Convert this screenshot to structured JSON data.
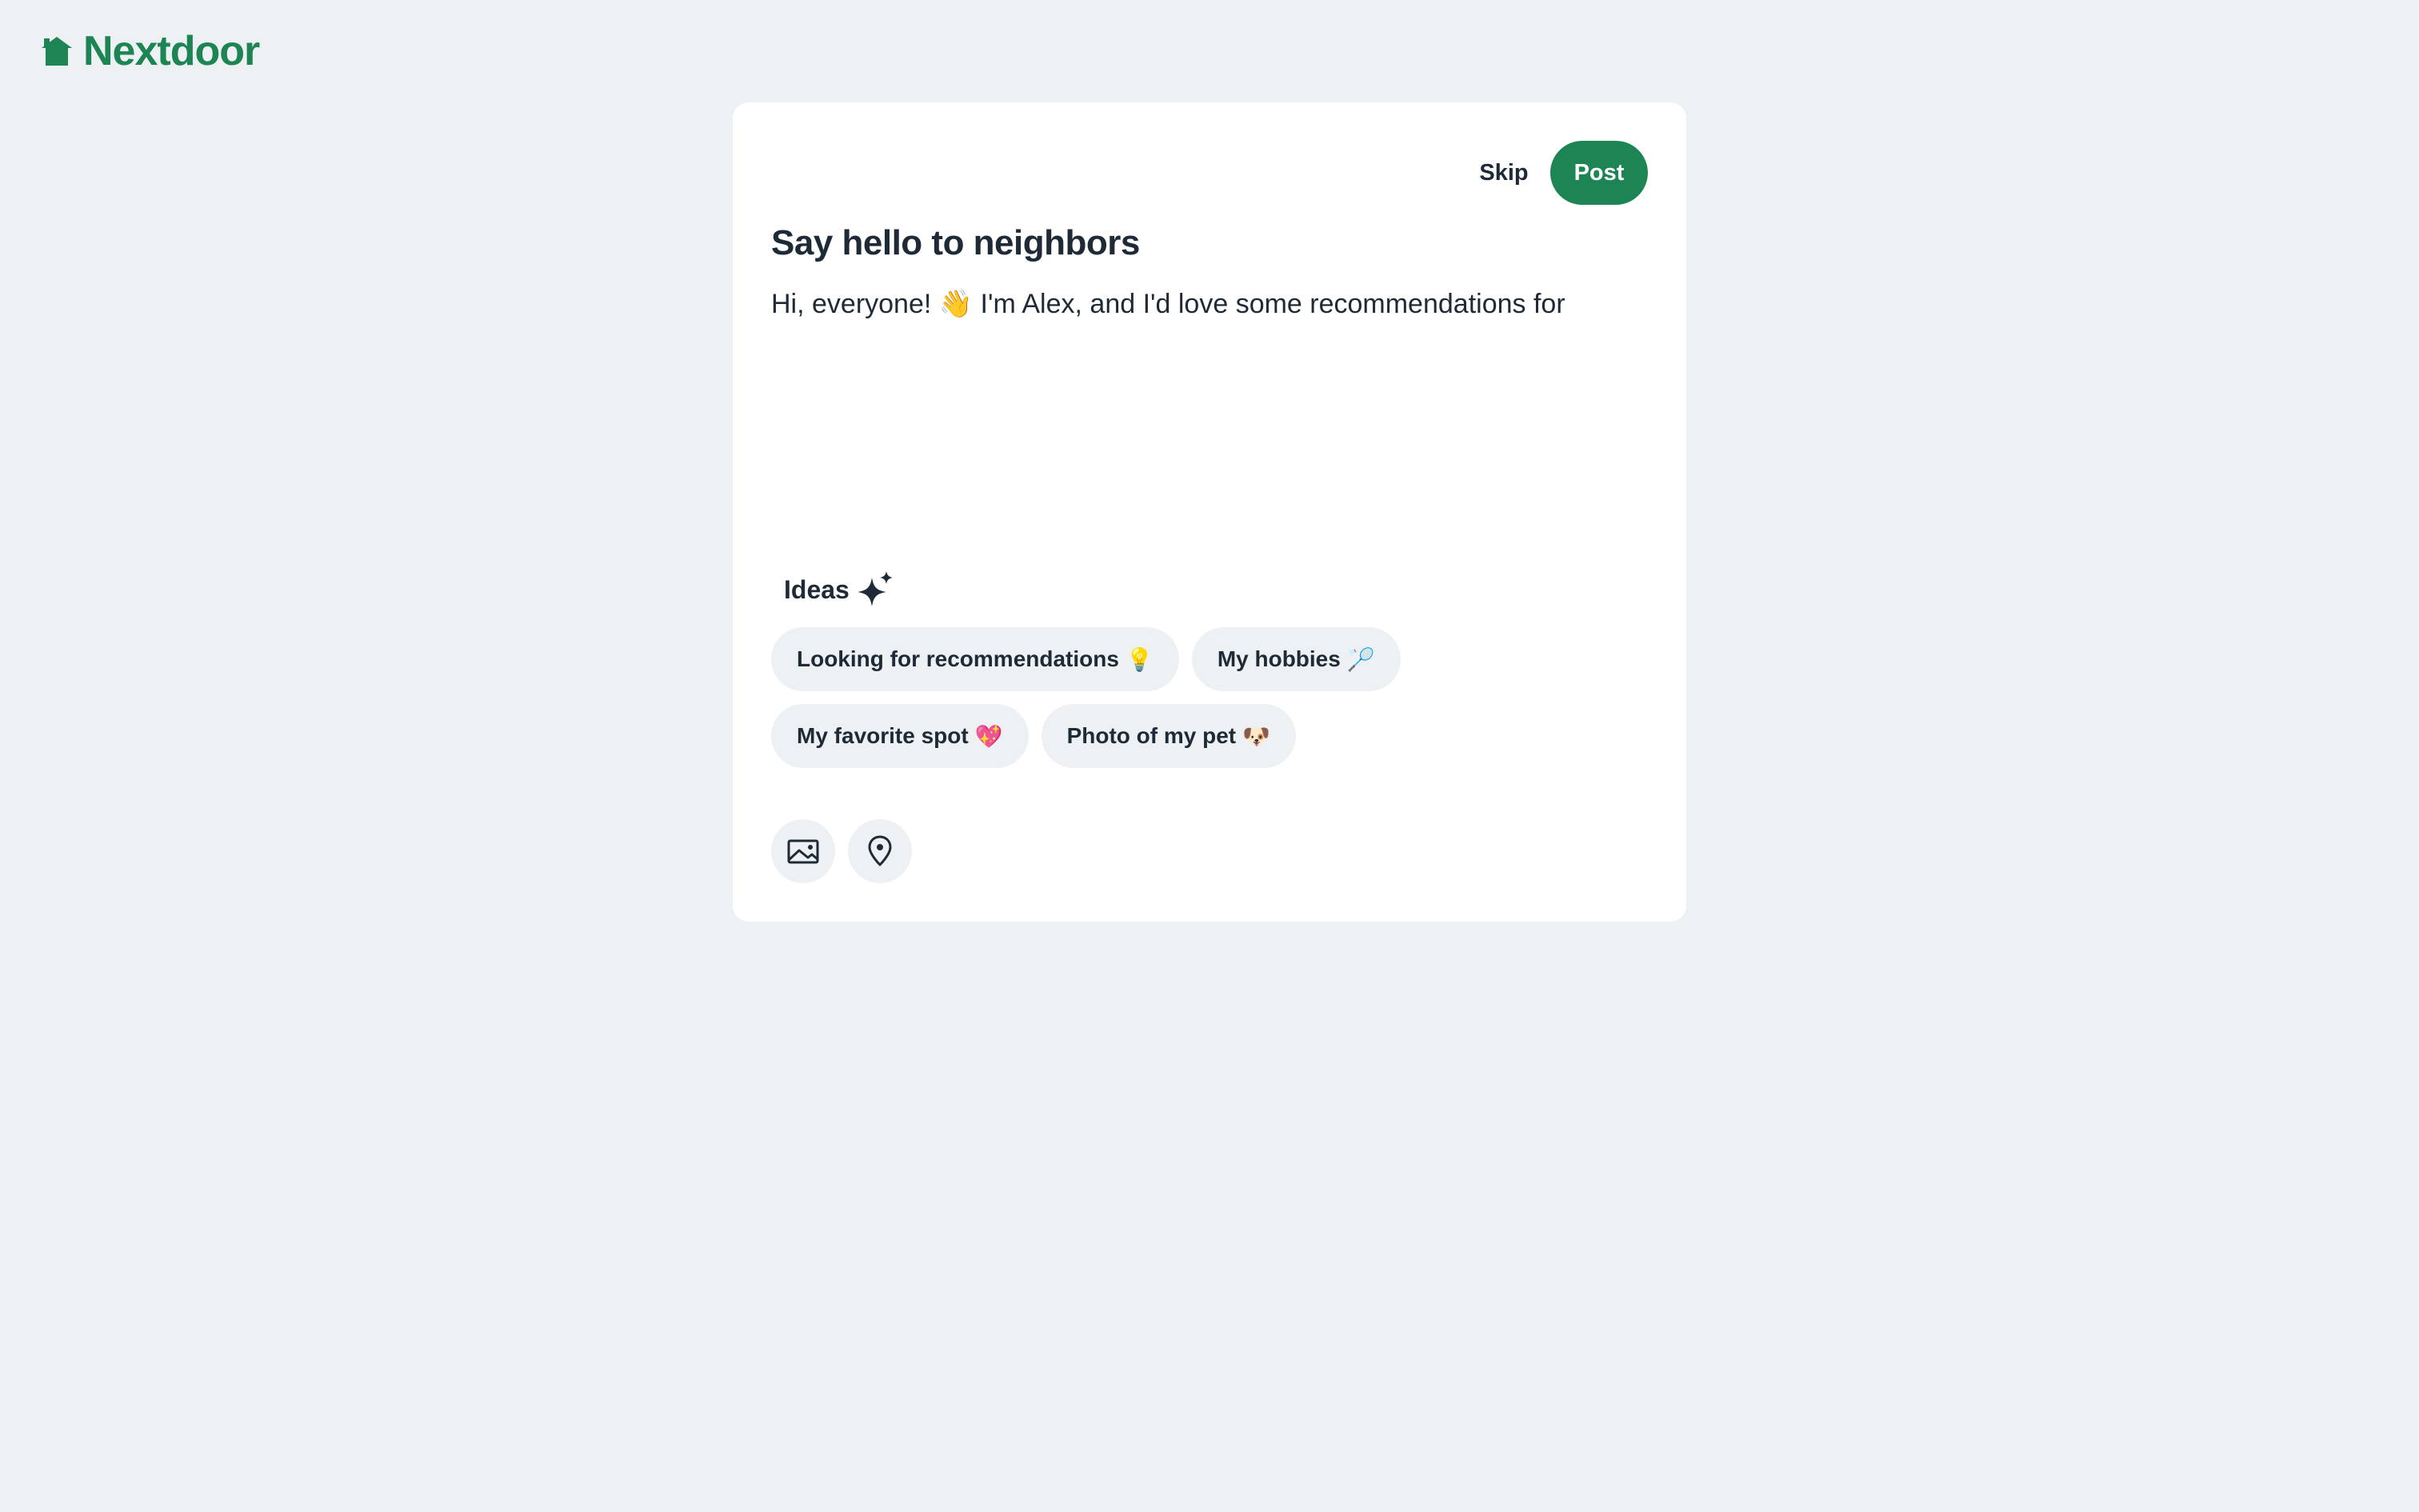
{
  "brand": {
    "name": "Nextdoor",
    "icon": "house-logo-icon",
    "color": "#1d8553"
  },
  "composer": {
    "skip_label": "Skip",
    "post_label": "Post",
    "title": "Say hello to neighbors",
    "body_text": "Hi, everyone! 👋 I'm Alex, and I'd love some recommendations for"
  },
  "ideas": {
    "label": "Ideas",
    "icon": "sparkle-icon",
    "chips": [
      {
        "label": "Looking for recommendations",
        "emoji": "💡"
      },
      {
        "label": "My hobbies",
        "emoji": "🏸"
      },
      {
        "label": "My favorite spot",
        "emoji": "💖"
      },
      {
        "label": "Photo of my pet",
        "emoji": "🐶"
      }
    ]
  },
  "toolbar": {
    "photo_icon": "image-icon",
    "location_icon": "location-pin-icon"
  },
  "colors": {
    "background": "#eef1f4",
    "card": "#ffffff",
    "accent": "#1d8553",
    "text": "#1f2a37",
    "chip_bg": "#eef1f4"
  }
}
